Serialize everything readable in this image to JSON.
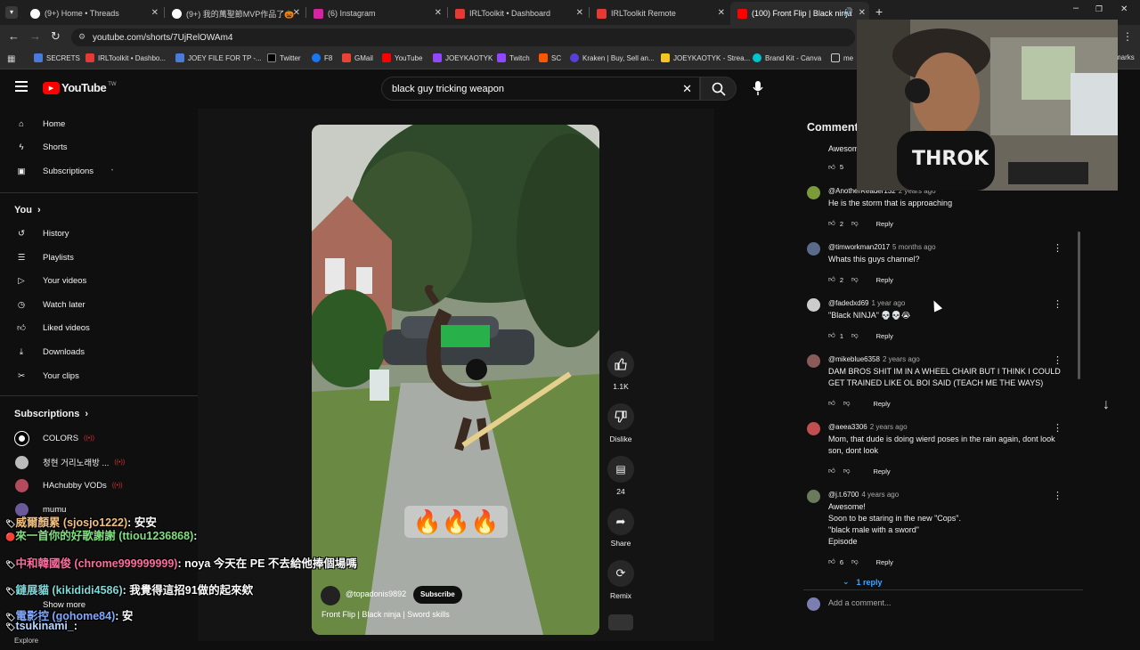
{
  "browser": {
    "tabs": [
      {
        "label": "(9+) Home • Threads",
        "fav": "#ffffff"
      },
      {
        "label": "(9+) 我的萬聖節MVP作品了🎃",
        "fav": "#ffffff"
      },
      {
        "label": "(6) Instagram",
        "fav": "#d6249f"
      },
      {
        "label": "IRLToolkit • Dashboard",
        "fav": "#e53935"
      },
      {
        "label": "IRLToolkit Remote",
        "fav": "#e53935"
      },
      {
        "label": "(100) Front Flip | Black ninja",
        "fav": "#ff0000"
      }
    ],
    "url": "youtube.com/shorts/7UjRelOWAm4",
    "bookmarks": [
      {
        "label": "SECRETS",
        "color": "#4a7bd8"
      },
      {
        "label": "IRLToolkit • Dashbo...",
        "color": "#e53935"
      },
      {
        "label": "JOEY FILE FOR TP -...",
        "color": "#4a7bd8"
      },
      {
        "label": "Twitter",
        "color": "#ffffff"
      },
      {
        "label": "F8",
        "color": "#1877f2"
      },
      {
        "label": "GMail",
        "color": "#ea4335"
      },
      {
        "label": "YouTube",
        "color": "#ff0000"
      },
      {
        "label": "JOEYKAOTYK",
        "color": "#9146ff"
      },
      {
        "label": "Twitch",
        "color": "#9146ff"
      },
      {
        "label": "SC",
        "color": "#ff5500"
      },
      {
        "label": "Kraken | Buy, Sell an...",
        "color": "#5741d9"
      },
      {
        "label": "JOEYKAOTYK - Strea...",
        "color": "#f3c623"
      },
      {
        "label": "Brand Kit - Canva",
        "color": "#00c4cc"
      },
      {
        "label": "me",
        "color": "#dedede"
      },
      {
        "label": "marks",
        "color": "#dedede"
      }
    ]
  },
  "youtube": {
    "logo_text": "YouTube",
    "logo_sup": "TW",
    "search_value": "black guy tricking weapon",
    "sidebar": {
      "main": [
        {
          "label": "Home",
          "icon": "home-icon"
        },
        {
          "label": "Shorts",
          "icon": "shorts-icon"
        },
        {
          "label": "Subscriptions",
          "icon": "subscriptions-icon"
        }
      ],
      "you_heading": "You",
      "you": [
        {
          "label": "History",
          "icon": "history-icon"
        },
        {
          "label": "Playlists",
          "icon": "playlists-icon"
        },
        {
          "label": "Your videos",
          "icon": "your-videos-icon"
        },
        {
          "label": "Watch later",
          "icon": "watch-later-icon"
        },
        {
          "label": "Liked videos",
          "icon": "liked-videos-icon"
        },
        {
          "label": "Downloads",
          "icon": "downloads-icon"
        },
        {
          "label": "Your clips",
          "icon": "clips-icon"
        }
      ],
      "subs_heading": "Subscriptions",
      "subs": [
        {
          "label": "COLORS",
          "live": "((•))"
        },
        {
          "label": "청현 거리노래방 ...",
          "live": "((•))"
        },
        {
          "label": "HAchubby VODs",
          "live": "((•))"
        },
        {
          "label": "mumu",
          "live": ""
        }
      ],
      "show_more": "Show more",
      "explore": "Explore"
    },
    "video": {
      "channel": "@topadonis9892",
      "subscribe": "Subscribe",
      "title": "Front Flip | Black ninja | Sword skills",
      "caption_emoji": "🔥🔥🔥"
    },
    "actions": {
      "likes": "1.1K",
      "dislike": "Dislike",
      "comments": "24",
      "share": "Share",
      "remix": "Remix"
    },
    "comments": {
      "heading": "Comments",
      "first_partial": {
        "text": "Awesome",
        "likes": "5"
      },
      "items": [
        {
          "user": "@AnotherReader132",
          "time": "2 years ago",
          "text": "He is the storm that is approaching",
          "likes": "2",
          "avatar": "#7b9b3a"
        },
        {
          "user": "@timworkman2017",
          "time": "5 months ago",
          "text": "Whats this guys channel?",
          "likes": "2",
          "avatar": "#5a6b8a"
        },
        {
          "user": "@fadedxd69",
          "time": "1 year ago",
          "text": "\"Black NINJA\" 💀💀😭",
          "likes": "1",
          "avatar": "#cccccc"
        },
        {
          "user": "@mikeblue6358",
          "time": "2 years ago",
          "text": "DAM BROS SHIT IM IN A WHEEL CHAIR BUT I THINK I COULD GET TRAINED LIKE OL BOI SAID (TEACH ME THE WAYS)",
          "likes": "",
          "avatar": "#8a5a5a"
        },
        {
          "user": "@aeea3306",
          "time": "2 years ago",
          "text": "Mom, that dude is doing wierd poses in the rain again, dont look son, dont look",
          "likes": "",
          "avatar": "#c05050"
        },
        {
          "user": "@j.t.6700",
          "time": "4 years ago",
          "text": "Awesome!\nSoon to be staring in the new \"Cops\".\n\"black male with a sword\"\nEpisode",
          "likes": "6",
          "avatar": "#6a7a5a"
        }
      ],
      "reply": "Reply",
      "replies_toggle": "1 reply",
      "add_placeholder": "Add a comment..."
    }
  },
  "stream_chat": [
    {
      "name": "威爾顏累 (sjosjo1222)",
      "msg": "安安",
      "color": "#f0c080"
    },
    {
      "name": "來一首你的好歌謝謝 (ttiou1236868)",
      "msg": "",
      "color": "#7fe07f"
    },
    {
      "name": "中和韓國俊 (chrome999999999)",
      "msg": "noya 今天在 PE 不去給他捧個場嗎",
      "color": "#ff6aa0"
    },
    {
      "name": "鏈展貓 (kikididi4586)",
      "msg": "我覺得這招91做的起來欸",
      "color": "#7fd8d8"
    },
    {
      "name": "電影控 (gohome84)",
      "msg": "安",
      "color": "#7fa8ff"
    },
    {
      "name": "tsukinami_",
      "msg": "",
      "color": "#b8d8ff"
    }
  ]
}
